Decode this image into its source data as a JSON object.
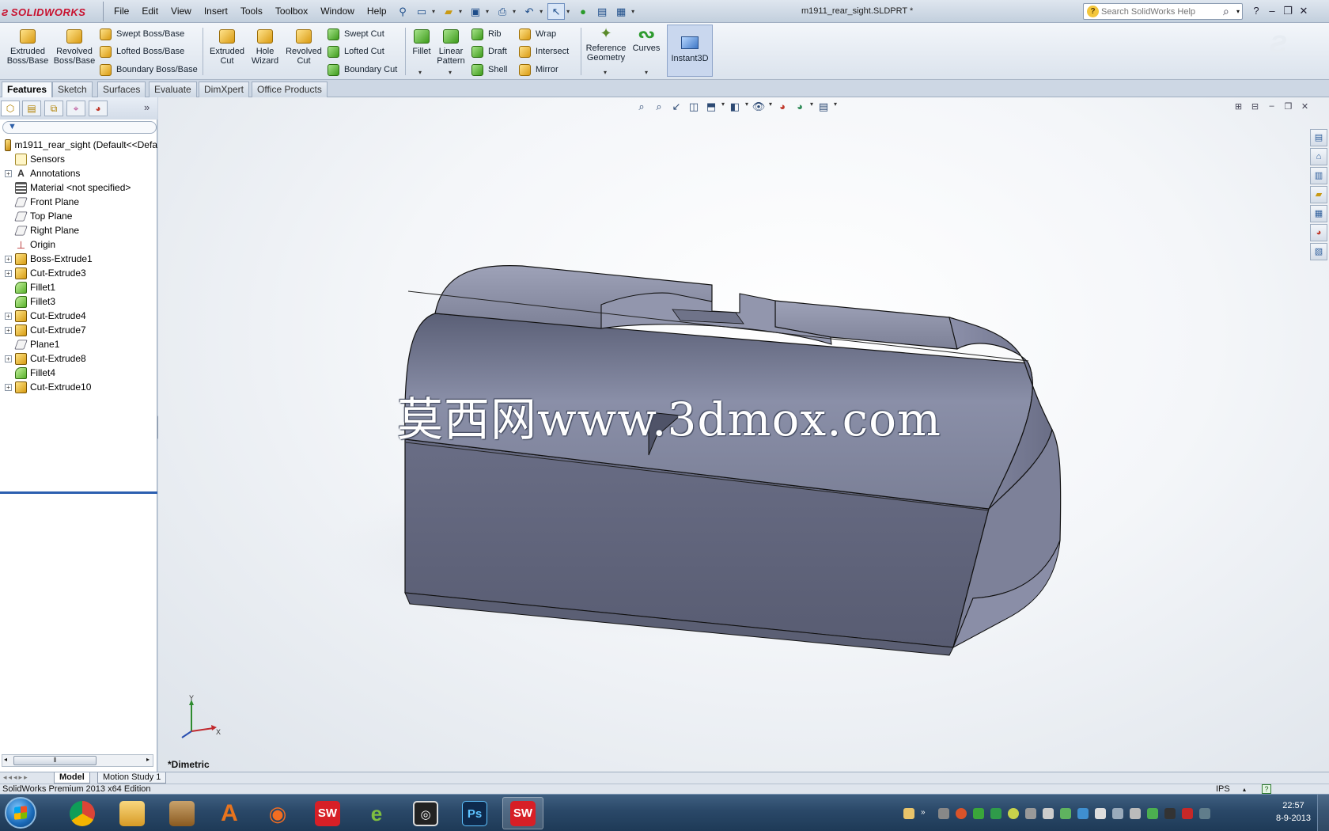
{
  "app": {
    "logo_text": "SOLIDWORKS",
    "document_title": "m1911_rear_sight.SLDPRT *",
    "search_placeholder": "Search SolidWorks Help"
  },
  "menu": [
    "File",
    "Edit",
    "View",
    "Insert",
    "Tools",
    "Toolbox",
    "Window",
    "Help"
  ],
  "quick_tools": [
    "pin-icon",
    "new-document-icon",
    "open-icon",
    "save-icon",
    "print-icon",
    "undo-icon",
    "select-icon",
    "rebuild-icon",
    "file-properties-icon",
    "options-icon"
  ],
  "command_manager": {
    "extruded_boss": "Extruded\nBoss/Base",
    "revolved_boss": "Revolved\nBoss/Base",
    "swept_boss": "Swept Boss/Base",
    "lofted_boss": "Lofted Boss/Base",
    "boundary_boss": "Boundary Boss/Base",
    "extruded_cut": "Extruded\nCut",
    "hole_wizard": "Hole\nWizard",
    "revolved_cut": "Revolved\nCut",
    "swept_cut": "Swept Cut",
    "lofted_cut": "Lofted Cut",
    "boundary_cut": "Boundary Cut",
    "fillet": "Fillet",
    "linear_pattern": "Linear\nPattern",
    "rib": "Rib",
    "draft": "Draft",
    "shell": "Shell",
    "wrap": "Wrap",
    "intersect": "Intersect",
    "mirror": "Mirror",
    "reference_geometry": "Reference\nGeometry",
    "curves": "Curves",
    "instant3d": "Instant3D"
  },
  "tabs": [
    "Features",
    "Sketch",
    "Surfaces",
    "Evaluate",
    "DimXpert",
    "Office Products"
  ],
  "active_tab": "Features",
  "feature_tree": {
    "root": "m1911_rear_sight  (Default<<Defa",
    "items": [
      {
        "label": "Sensors",
        "icon": "sensors-icon",
        "expandable": false
      },
      {
        "label": "Annotations",
        "icon": "annotations-icon",
        "expandable": true
      },
      {
        "label": "Material <not specified>",
        "icon": "material-icon",
        "expandable": false
      },
      {
        "label": "Front Plane",
        "icon": "plane-icon",
        "expandable": false
      },
      {
        "label": "Top Plane",
        "icon": "plane-icon",
        "expandable": false
      },
      {
        "label": "Right Plane",
        "icon": "plane-icon",
        "expandable": false
      },
      {
        "label": "Origin",
        "icon": "origin-icon",
        "expandable": false
      },
      {
        "label": "Boss-Extrude1",
        "icon": "extrude-icon",
        "expandable": true
      },
      {
        "label": "Cut-Extrude3",
        "icon": "extrude-icon",
        "expandable": true
      },
      {
        "label": "Fillet1",
        "icon": "fillet-icon",
        "expandable": false
      },
      {
        "label": "Fillet3",
        "icon": "fillet-icon",
        "expandable": false
      },
      {
        "label": "Cut-Extrude4",
        "icon": "extrude-icon",
        "expandable": true
      },
      {
        "label": "Cut-Extrude7",
        "icon": "extrude-icon",
        "expandable": true
      },
      {
        "label": "Plane1",
        "icon": "plane-icon",
        "expandable": false
      },
      {
        "label": "Cut-Extrude8",
        "icon": "extrude-icon",
        "expandable": true
      },
      {
        "label": "Fillet4",
        "icon": "fillet-icon",
        "expandable": false
      },
      {
        "label": "Cut-Extrude10",
        "icon": "extrude-icon",
        "expandable": true
      }
    ]
  },
  "viewport": {
    "watermark": "莫西网www.3dmox.com",
    "view_name": "*Dimetric",
    "triad_x": "X",
    "triad_y": "Y"
  },
  "bottom_tabs": [
    "Model",
    "Motion Study 1"
  ],
  "status": {
    "text": "SolidWorks Premium 2013 x64 Edition",
    "units": "IPS"
  },
  "taskbar": {
    "apps": [
      "chrome-icon",
      "explorer-icon",
      "file-manager-icon",
      "autodesk-icon",
      "origin-icon",
      "solidworks-icon",
      "enterprise-icon",
      "steam-like-icon",
      "photoshop-icon",
      "solidworks-active-icon"
    ],
    "time": "22:57",
    "date": "8-9-2013"
  }
}
